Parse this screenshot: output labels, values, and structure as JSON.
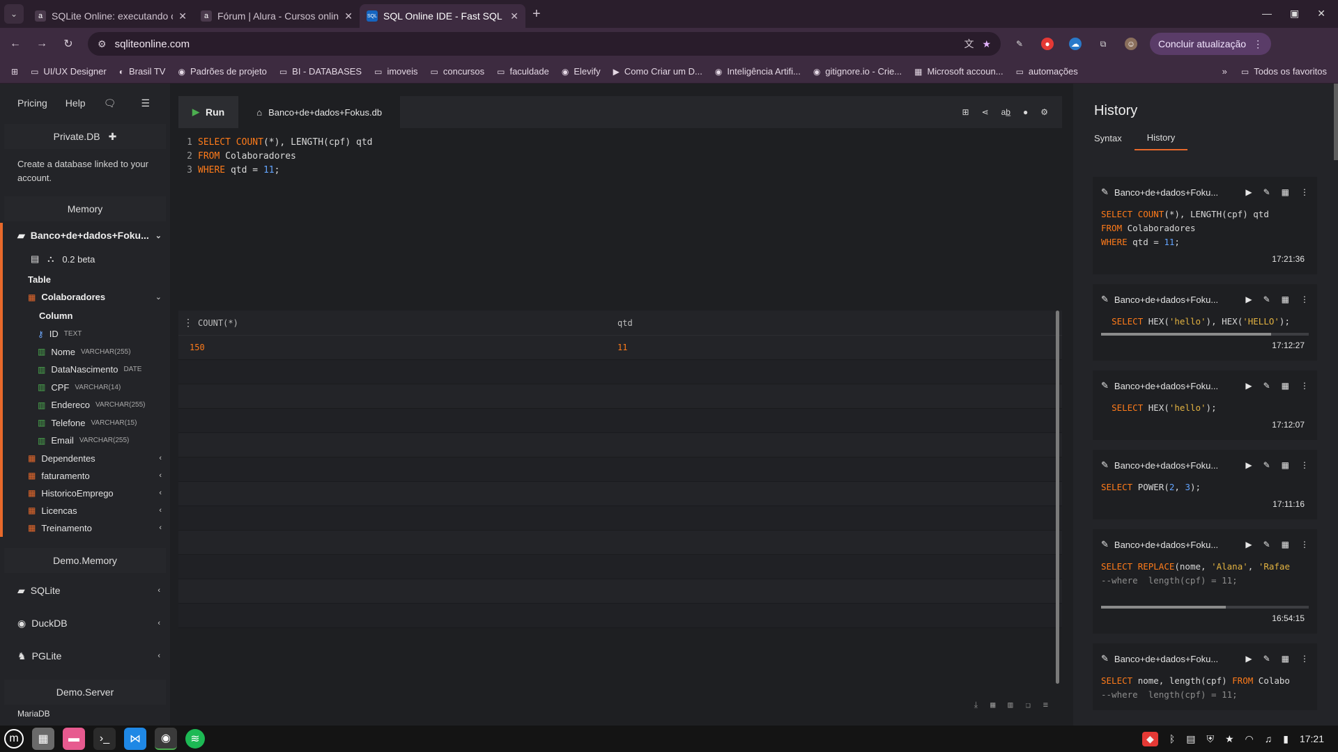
{
  "browser": {
    "tabs": [
      {
        "title": "SQLite Online: executando c",
        "favicon": "a",
        "active": false
      },
      {
        "title": "Fórum | Alura - Cursos online",
        "favicon": "a",
        "active": false
      },
      {
        "title": "SQL Online IDE - Fast SQL Ed",
        "favicon": "SQL",
        "active": true
      }
    ],
    "url": "sqliteonline.com",
    "update_button": "Concluir atualização",
    "bookmarks": [
      {
        "label": "UI/UX Designer",
        "icon": "folder-icon"
      },
      {
        "label": "Brasil TV",
        "icon": "tv-icon"
      },
      {
        "label": "Padrões de projeto",
        "icon": "site-icon"
      },
      {
        "label": "BI - DATABASES",
        "icon": "folder-icon"
      },
      {
        "label": "imoveis",
        "icon": "folder-icon"
      },
      {
        "label": "concursos",
        "icon": "folder-icon"
      },
      {
        "label": "faculdade",
        "icon": "folder-icon"
      },
      {
        "label": "Elevify",
        "icon": "site-icon"
      },
      {
        "label": "Como Criar um D...",
        "icon": "video-icon"
      },
      {
        "label": "Inteligência Artifi...",
        "icon": "site-icon"
      },
      {
        "label": "gitignore.io - Crie...",
        "icon": "site-icon"
      },
      {
        "label": "Microsoft accoun...",
        "icon": "microsoft-icon"
      },
      {
        "label": "automações",
        "icon": "folder-icon"
      }
    ],
    "all_bookmarks": "Todos os favoritos"
  },
  "sidebar": {
    "top_links": [
      "Pricing",
      "Help"
    ],
    "private_db": "Private.DB",
    "private_note": "Create a database linked to your account.",
    "memory": "Memory",
    "database": {
      "name": "Banco+de+dados+Foku...",
      "version": "0.2 beta",
      "table_label": "Table",
      "expanded_table": "Colaboradores",
      "column_label": "Column",
      "columns": [
        {
          "name": "ID",
          "type": "TEXT",
          "key": true
        },
        {
          "name": "Nome",
          "type": "VARCHAR(255)",
          "key": false
        },
        {
          "name": "DataNascimento",
          "type": "DATE",
          "key": false
        },
        {
          "name": "CPF",
          "type": "VARCHAR(14)",
          "key": false
        },
        {
          "name": "Endereco",
          "type": "VARCHAR(255)",
          "key": false
        },
        {
          "name": "Telefone",
          "type": "VARCHAR(15)",
          "key": false
        },
        {
          "name": "Email",
          "type": "VARCHAR(255)",
          "key": false
        }
      ],
      "other_tables": [
        "Dependentes",
        "faturamento",
        "HistoricoEmprego",
        "Licencas",
        "Treinamento"
      ]
    },
    "demo_memory": "Demo.Memory",
    "demo_items": [
      "SQLite",
      "DuckDB",
      "PGLite"
    ],
    "demo_server": "Demo.Server",
    "demo_server_partial": "MariaDB"
  },
  "editor": {
    "run_label": "Run",
    "db_tab": "Banco+de+dados+Fokus.db",
    "lines": [
      {
        "n": "1",
        "tokens": [
          [
            "kw",
            "SELECT "
          ],
          [
            "kw",
            "COUNT"
          ],
          [
            "txt",
            "(*), LENGTH(cpf) qtd"
          ]
        ]
      },
      {
        "n": "2",
        "tokens": [
          [
            "kw",
            "FROM "
          ],
          [
            "txt",
            "Colaboradores"
          ]
        ]
      },
      {
        "n": "3",
        "tokens": [
          [
            "kw",
            "WHERE "
          ],
          [
            "txt",
            "qtd = "
          ],
          [
            "num",
            "11"
          ],
          [
            "txt",
            ";"
          ]
        ]
      }
    ]
  },
  "result": {
    "columns": [
      "COUNT(*)",
      "qtd"
    ],
    "rows": [
      [
        "150",
        "11"
      ]
    ],
    "empty_rows": 11
  },
  "history": {
    "title": "History",
    "tabs": [
      "Syntax",
      "History"
    ],
    "active_tab": "History",
    "entries": [
      {
        "db": "Banco+de+dados+Foku...",
        "time": "17:21:36",
        "scroll": null,
        "lines": [
          [
            [
              "kw",
              "SELECT "
            ],
            [
              "kw",
              "COUNT"
            ],
            [
              "txt",
              "(*), LENGTH(cpf) qtd"
            ]
          ],
          [
            [
              "kw",
              "FROM "
            ],
            [
              "txt",
              "Colaboradores"
            ]
          ],
          [
            [
              "kw",
              "WHERE "
            ],
            [
              "txt",
              "qtd = "
            ],
            [
              "num",
              "11"
            ],
            [
              "txt",
              ";"
            ]
          ]
        ]
      },
      {
        "db": "Banco+de+dados+Foku...",
        "time": "17:12:27",
        "scroll": 0.82,
        "lines": [
          [
            [
              "txt",
              "  "
            ],
            [
              "kw",
              "SELECT "
            ],
            [
              "txt",
              "HEX("
            ],
            [
              "str",
              "'hello'"
            ],
            [
              "txt",
              "), HEX("
            ],
            [
              "str",
              "'HELLO'"
            ],
            [
              "txt",
              ");"
            ]
          ]
        ]
      },
      {
        "db": "Banco+de+dados+Foku...",
        "time": "17:12:07",
        "scroll": null,
        "lines": [
          [
            [
              "txt",
              "  "
            ],
            [
              "kw",
              "SELECT "
            ],
            [
              "txt",
              "HEX("
            ],
            [
              "str",
              "'hello'"
            ],
            [
              "txt",
              ");"
            ]
          ]
        ]
      },
      {
        "db": "Banco+de+dados+Foku...",
        "time": "17:11:16",
        "scroll": null,
        "lines": [
          [
            [
              "kw",
              "SELECT "
            ],
            [
              "txt",
              "POWER("
            ],
            [
              "num",
              "2"
            ],
            [
              "txt",
              ", "
            ],
            [
              "num",
              "3"
            ],
            [
              "txt",
              ");"
            ]
          ]
        ]
      },
      {
        "db": "Banco+de+dados+Foku...",
        "time": "16:54:15",
        "scroll": 0.6,
        "lines": [
          [
            [
              "kw",
              "SELECT "
            ],
            [
              "kw",
              "REPLACE"
            ],
            [
              "txt",
              "(nome, "
            ],
            [
              "str",
              "'Alana'"
            ],
            [
              "txt",
              ", "
            ],
            [
              "str",
              "'Rafae"
            ]
          ],
          [
            [
              "cmt",
              "--where  length(cpf) = 11;"
            ]
          ],
          [
            [
              "txt",
              " "
            ]
          ]
        ]
      },
      {
        "db": "Banco+de+dados+Foku...",
        "time": "",
        "scroll": null,
        "lines": [
          [
            [
              "kw",
              "SELECT "
            ],
            [
              "txt",
              "nome, length(cpf) "
            ],
            [
              "kw",
              "FROM "
            ],
            [
              "txt",
              "Colabo"
            ]
          ],
          [
            [
              "cmt",
              "--where  length(cpf) = 11;"
            ]
          ]
        ]
      }
    ]
  },
  "taskbar": {
    "clock": "17:21",
    "apps": [
      "mint-menu-icon",
      "calculator-icon",
      "files-icon",
      "terminal-icon",
      "vscode-icon",
      "chrome-icon",
      "spotify-icon"
    ]
  },
  "colors": {
    "accent": "#e8692b",
    "keyword": "#ff7b1a",
    "number": "#63a4ff",
    "string": "#e3b341"
  }
}
